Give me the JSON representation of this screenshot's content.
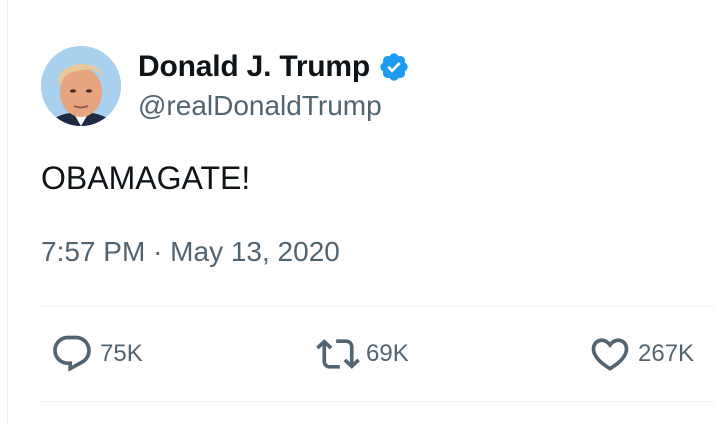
{
  "author": {
    "display_name": "Donald J. Trump",
    "handle": "@realDonaldTrump",
    "verified": true,
    "verified_color": "#1d9bf0"
  },
  "tweet": {
    "text": "OBAMAGATE!",
    "time": "7:57 PM",
    "separator": "·",
    "date": "May 13, 2020"
  },
  "actions": {
    "reply_count": "75K",
    "retweet_count": "69K",
    "like_count": "267K"
  },
  "colors": {
    "text_primary": "#0f1419",
    "text_secondary": "#536471",
    "divider": "#eff3f4"
  },
  "icons": {
    "reply": "speech-bubble-icon",
    "retweet": "retweet-arrows-icon",
    "like": "heart-outline-icon",
    "verified": "verified-badge-icon"
  }
}
